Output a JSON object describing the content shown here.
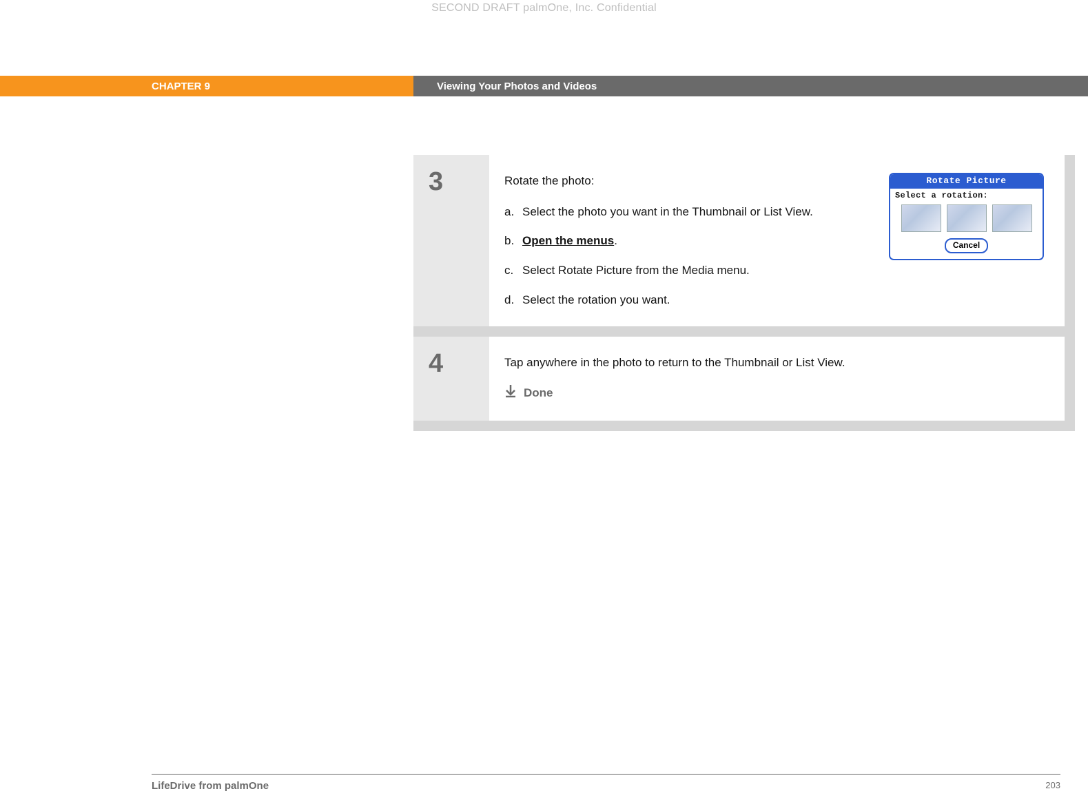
{
  "watermark": "SECOND DRAFT palmOne, Inc.  Confidential",
  "header": {
    "chapter": "CHAPTER 9",
    "title": "Viewing Your Photos and Videos"
  },
  "steps": [
    {
      "number": "3",
      "intro": "Rotate the photo:",
      "substeps": [
        {
          "letter": "a.",
          "text": "Select the photo you want in the Thumbnail or List View."
        },
        {
          "letter": "b.",
          "text_link": "Open the menus",
          "suffix": "."
        },
        {
          "letter": "c.",
          "text": "Select Rotate Picture from the Media menu."
        },
        {
          "letter": "d.",
          "text": "Select the rotation you want."
        }
      ],
      "dialog": {
        "title": "Rotate Picture",
        "label": "Select a rotation:",
        "cancel": "Cancel"
      }
    },
    {
      "number": "4",
      "intro": "Tap anywhere in the photo to return to the Thumbnail or List View.",
      "done": "Done"
    }
  ],
  "footer": {
    "product": "LifeDrive from palmOne",
    "page": "203"
  }
}
